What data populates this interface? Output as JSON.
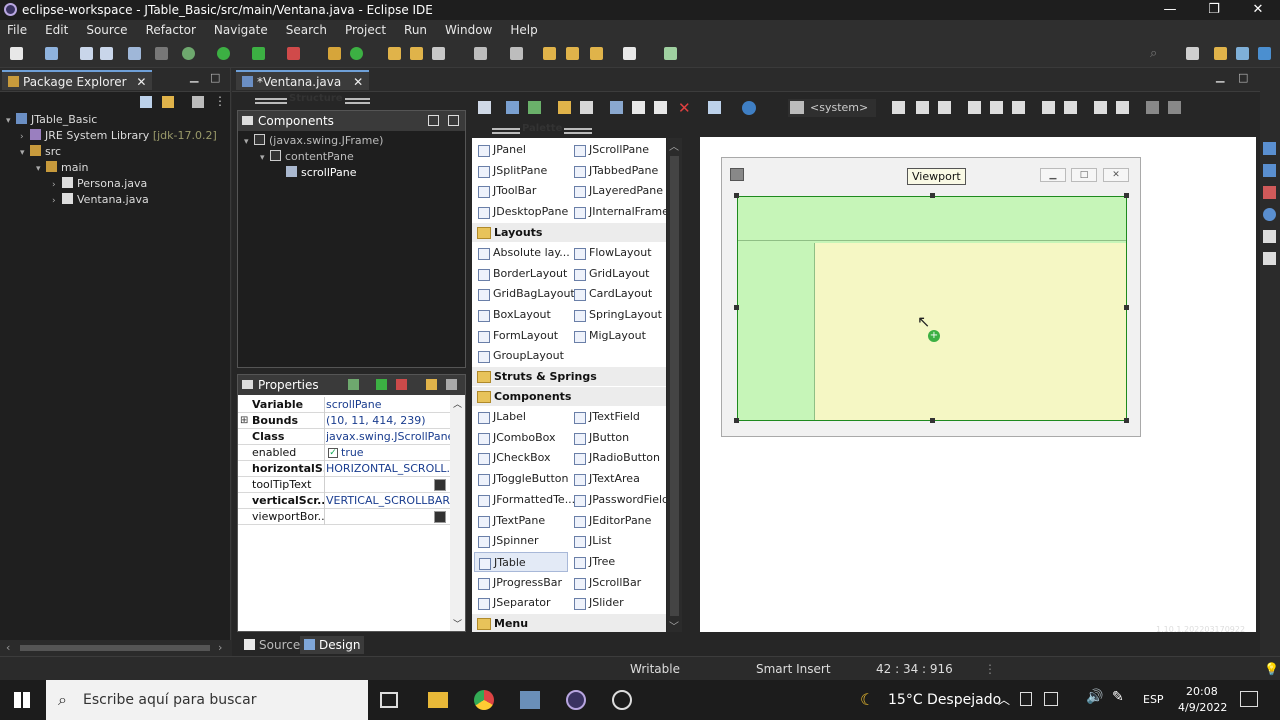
{
  "window": {
    "title": "eclipse-workspace - JTable_Basic/src/main/Ventana.java - Eclipse IDE",
    "minimize": "—",
    "maximize": "❐",
    "close": "✕"
  },
  "menu": [
    "File",
    "Edit",
    "Source",
    "Refactor",
    "Navigate",
    "Search",
    "Project",
    "Run",
    "Window",
    "Help"
  ],
  "package_explorer": {
    "tab_label": "Package Explorer",
    "tree": [
      {
        "label": "JTable_Basic",
        "depth": 0
      },
      {
        "label": "JRE System Library",
        "suffix": "[jdk-17.0.2]",
        "depth": 1
      },
      {
        "label": "src",
        "depth": 1
      },
      {
        "label": "main",
        "depth": 2
      },
      {
        "label": "Persona.java",
        "depth": 3
      },
      {
        "label": "Ventana.java",
        "depth": 3
      }
    ]
  },
  "editor": {
    "tab_label": "*Ventana.java",
    "structure_label": "Structure",
    "palette_label": "Palette",
    "system_label": "<system>"
  },
  "components": {
    "header": "Components",
    "tree": [
      "(javax.swing.JFrame)",
      "contentPane",
      "scrollPane"
    ]
  },
  "properties": {
    "header": "Properties",
    "rows": [
      {
        "key": "Variable",
        "value": "scrollPane",
        "bold": true
      },
      {
        "key": "Bounds",
        "value": "(10, 11, 414, 239)",
        "bold": true
      },
      {
        "key": "Class",
        "value": "javax.swing.JScrollPane",
        "bold": true
      },
      {
        "key": "enabled",
        "value": "true",
        "bold": false
      },
      {
        "key": "horizontalS...",
        "value": "HORIZONTAL_SCROLL...",
        "bold": true
      },
      {
        "key": "toolTipText",
        "value": "",
        "bold": false
      },
      {
        "key": "verticalScr...",
        "value": "VERTICAL_SCROLLBAR...",
        "bold": true
      },
      {
        "key": "viewportBor...",
        "value": "",
        "bold": false
      }
    ]
  },
  "palette": {
    "rows": [
      {
        "type": "item",
        "cols": [
          "JPanel",
          "JScrollPane"
        ]
      },
      {
        "type": "item",
        "cols": [
          "JSplitPane",
          "JTabbedPane"
        ]
      },
      {
        "type": "item",
        "cols": [
          "JToolBar",
          "JLayeredPane"
        ]
      },
      {
        "type": "item",
        "cols": [
          "JDesktopPane",
          "JInternalFrame"
        ]
      },
      {
        "type": "cat",
        "label": "Layouts"
      },
      {
        "type": "item",
        "cols": [
          "Absolute lay...",
          "FlowLayout"
        ]
      },
      {
        "type": "item",
        "cols": [
          "BorderLayout",
          "GridLayout"
        ]
      },
      {
        "type": "item",
        "cols": [
          "GridBagLayout",
          "CardLayout"
        ]
      },
      {
        "type": "item",
        "cols": [
          "BoxLayout",
          "SpringLayout"
        ]
      },
      {
        "type": "item",
        "cols": [
          "FormLayout",
          "MigLayout"
        ]
      },
      {
        "type": "item",
        "cols": [
          "GroupLayout",
          ""
        ]
      },
      {
        "type": "cat",
        "label": "Struts & Springs"
      },
      {
        "type": "cat",
        "label": "Components"
      },
      {
        "type": "item",
        "cols": [
          "JLabel",
          "JTextField"
        ]
      },
      {
        "type": "item",
        "cols": [
          "JComboBox",
          "JButton"
        ]
      },
      {
        "type": "item",
        "cols": [
          "JCheckBox",
          "JRadioButton"
        ]
      },
      {
        "type": "item",
        "cols": [
          "JToggleButton",
          "JTextArea"
        ]
      },
      {
        "type": "item",
        "cols": [
          "JFormattedTe...",
          "JPasswordField"
        ]
      },
      {
        "type": "item",
        "cols": [
          "JTextPane",
          "JEditorPane"
        ]
      },
      {
        "type": "item",
        "cols": [
          "JSpinner",
          "JList"
        ]
      },
      {
        "type": "item",
        "cols": [
          "JTable",
          "JTree"
        ],
        "selected": 0
      },
      {
        "type": "item",
        "cols": [
          "JProgressBar",
          "JScrollBar"
        ]
      },
      {
        "type": "item",
        "cols": [
          "JSeparator",
          "JSlider"
        ]
      },
      {
        "type": "cat",
        "label": "Menu"
      },
      {
        "type": "cat",
        "label": "JGoodies"
      }
    ]
  },
  "design": {
    "tooltip": "Viewport",
    "watermark": "1.10.1.202203170922"
  },
  "bottom_tabs": {
    "source": "Source",
    "design": "Design"
  },
  "status": {
    "writable": "Writable",
    "insert": "Smart Insert",
    "position": "42 : 34 : 916"
  },
  "taskbar": {
    "search_placeholder": "Escribe aquí para buscar",
    "weather": "15°C  Despejado",
    "language": "ESP",
    "time": "20:08",
    "date": "4/9/2022"
  },
  "colors": {
    "frame_green": "#c6f5b8",
    "frame_yellow": "#f5f7c4",
    "selection_border": "#1e8a1e"
  }
}
